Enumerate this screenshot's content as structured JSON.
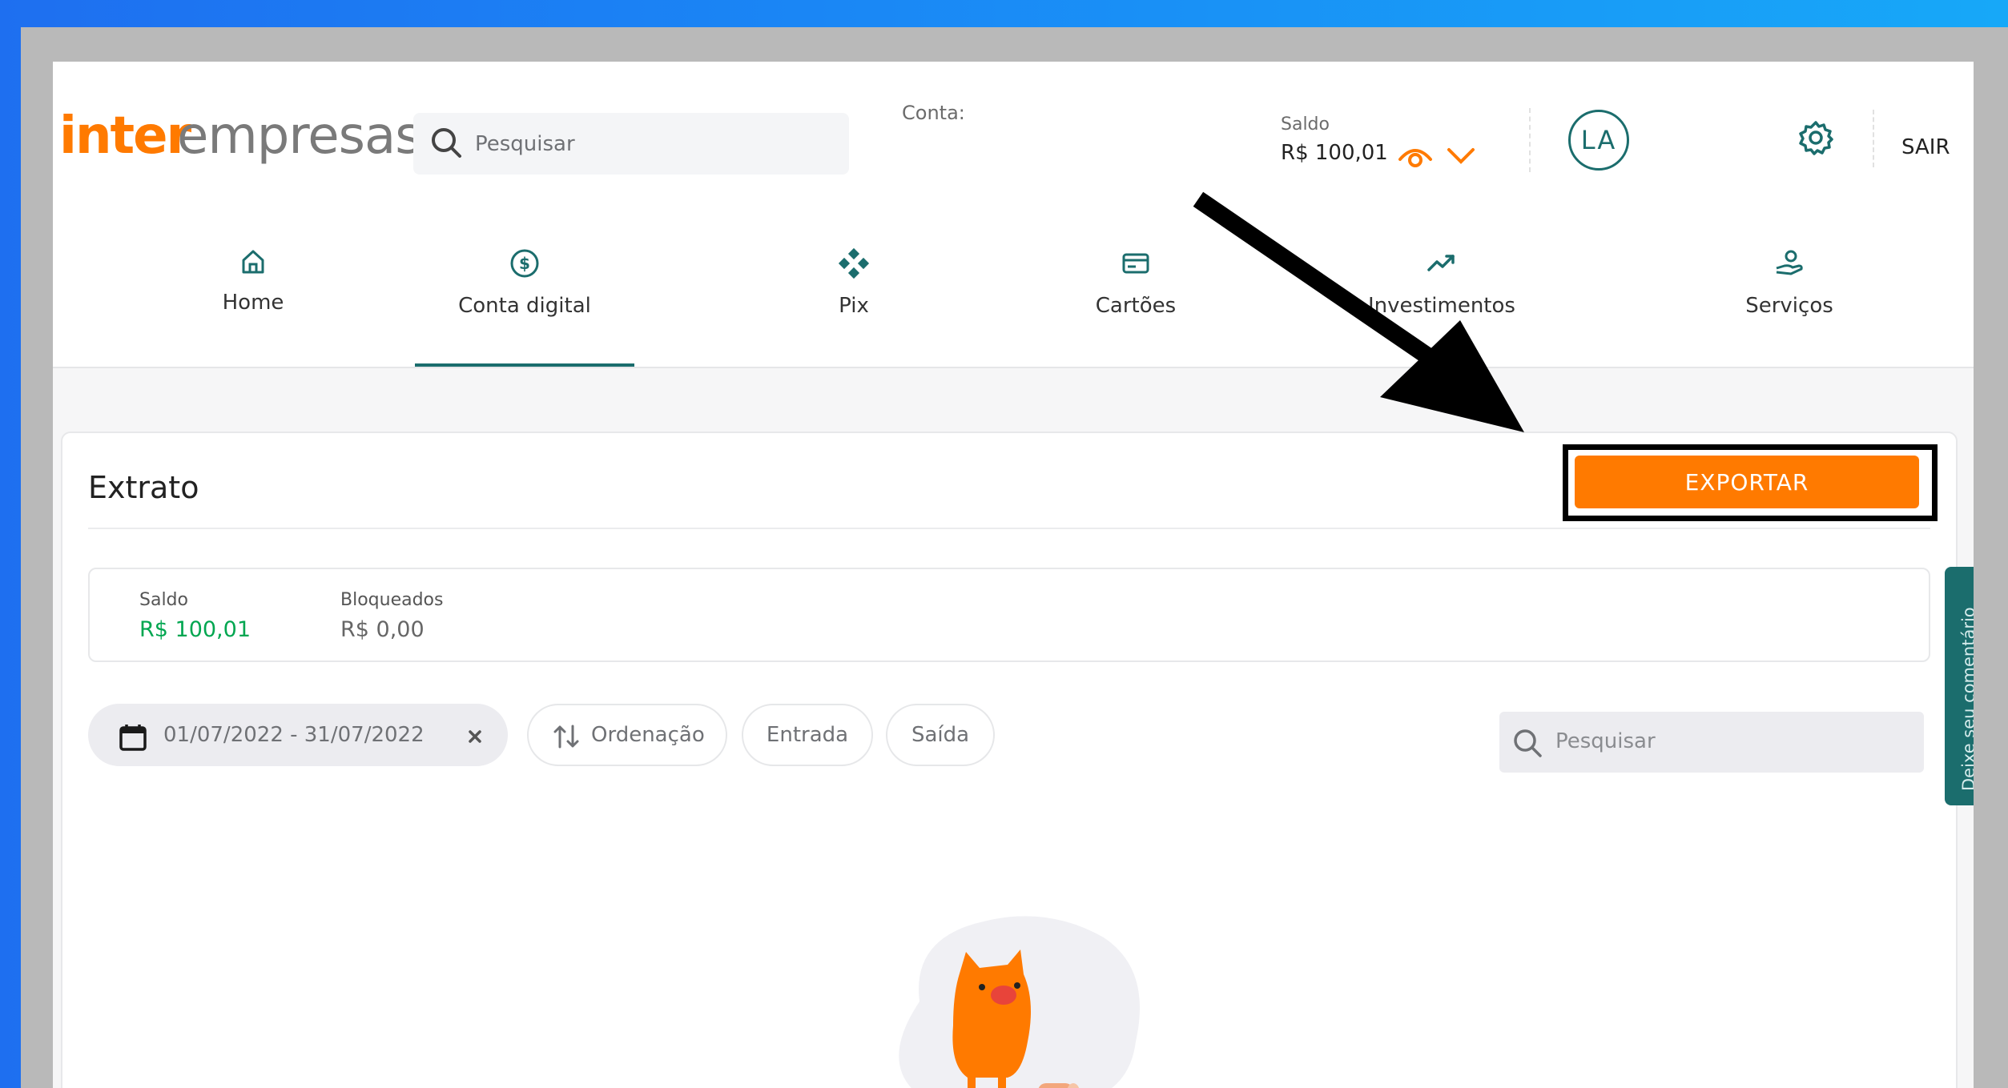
{
  "header": {
    "logo_inter": "inter",
    "logo_empresas": "empresas",
    "search_placeholder": "Pesquisar",
    "conta_label": "Conta:",
    "saldo_label": "Saldo",
    "saldo_value": "R$ 100,01",
    "avatar_initials": "LA",
    "logout_label": "SAIR"
  },
  "nav": {
    "items": [
      {
        "label": "Home",
        "icon": "home-icon"
      },
      {
        "label": "Conta digital",
        "icon": "dollar-circle-icon"
      },
      {
        "label": "Pix",
        "icon": "pix-icon"
      },
      {
        "label": "Cartões",
        "icon": "card-icon"
      },
      {
        "label": "Investimentos",
        "icon": "trend-up-icon"
      },
      {
        "label": "Serviços",
        "icon": "services-icon"
      }
    ],
    "active": "Conta digital"
  },
  "extrato": {
    "title": "Extrato",
    "export_label": "EXPORTAR",
    "saldo_label": "Saldo",
    "saldo_value": "R$ 100,01",
    "bloqueados_label": "Bloqueados",
    "bloqueados_value": "R$ 0,00",
    "filters": {
      "date_range": "01/07/2022 - 31/07/2022",
      "ordenacao": "Ordenação",
      "entrada": "Entrada",
      "saida": "Saída"
    },
    "search_placeholder": "Pesquisar"
  },
  "feedback_tab": "Deixe seu comentário",
  "colors": {
    "brand_orange": "#ff7a00",
    "brand_teal": "#1b6d6d",
    "positive_green": "#00a650"
  }
}
